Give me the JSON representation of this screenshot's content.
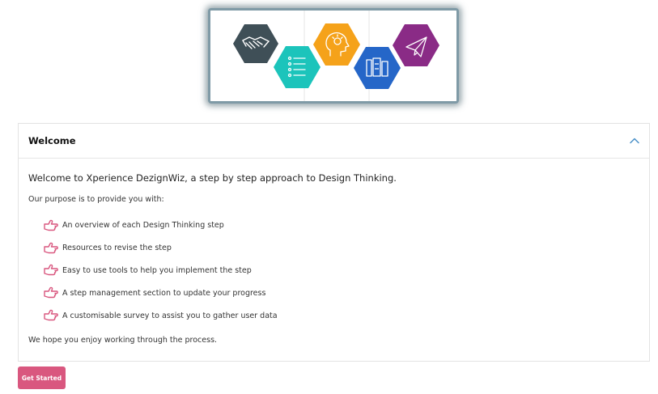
{
  "banner": {
    "icons": [
      "handshake-icon",
      "checklist-icon",
      "idea-head-icon",
      "prototype-blueprint-icon",
      "paper-plane-icon"
    ]
  },
  "panel": {
    "title": "Welcome",
    "intro": "Welcome to Xperience DezignWiz, a step by step approach to Design Thinking.",
    "purpose": "Our purpose is to provide you with:",
    "items": [
      {
        "label": "An overview of each Design Thinking step"
      },
      {
        "label": "Resources to revise the step"
      },
      {
        "label": "Easy to use tools to help you implement the step"
      },
      {
        "label": "A step management section to update your progress"
      },
      {
        "label": "A customisable survey to assist you to gather user data"
      }
    ],
    "closing": "We hope you enjoy working through the process."
  },
  "button": {
    "label": "Get Started"
  },
  "colors": {
    "accent": "#d9577f",
    "chevron": "#4a90c8",
    "hex_dark": "#3f4f57",
    "hex_teal": "#1cc4bb",
    "hex_orange": "#f5a21a",
    "hex_blue": "#2566c8",
    "hex_purple": "#8a2b86"
  }
}
